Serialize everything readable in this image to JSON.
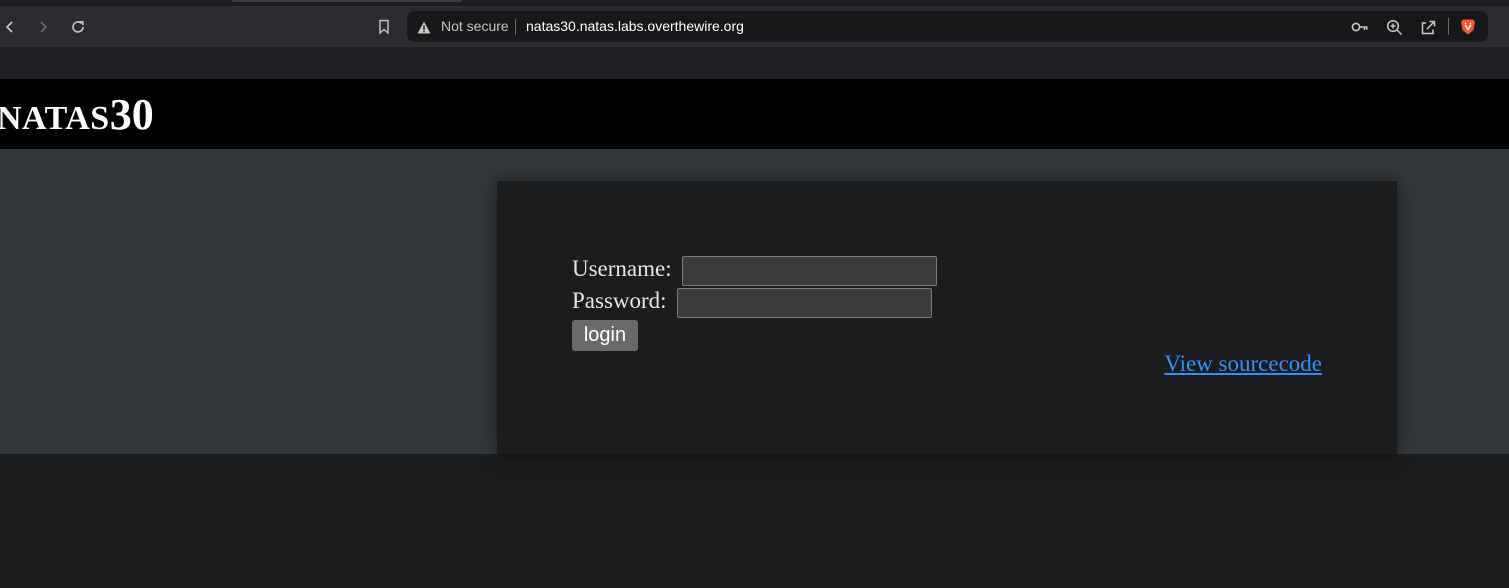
{
  "browser": {
    "security_label": "Not secure",
    "url": "natas30.natas.labs.overthewire.org",
    "icons": {
      "back": "chevron-left-icon",
      "forward": "chevron-right-icon",
      "reload": "reload-icon",
      "bookmark": "bookmark-icon",
      "warning": "warning-icon",
      "key": "key-icon",
      "zoom": "zoom-icon",
      "share": "share-icon",
      "brave": "brave-lion-icon"
    }
  },
  "header": {
    "logo_prefix": "NATAS",
    "logo_number": "30"
  },
  "form": {
    "username_label": "Username:",
    "username_value": "",
    "password_label": "Password:",
    "password_value": "",
    "login_label": "login"
  },
  "link": {
    "view_source": "View sourcecode"
  },
  "colors": {
    "page_bg": "#1b1c1e",
    "content_bg": "#34383b",
    "header_bg": "#000000",
    "link": "#3391ff",
    "button": "#6a6a6a",
    "brave_orange": "#fb542b"
  }
}
